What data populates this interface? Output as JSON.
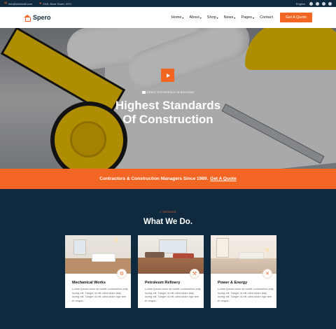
{
  "topbar": {
    "email": "info@webmail.com",
    "address": "24/A, Near Tower, NYC",
    "language": "English"
  },
  "header": {
    "brand": "Spero",
    "nav": [
      {
        "label": "Home",
        "has_dropdown": true
      },
      {
        "label": "About",
        "has_dropdown": true
      },
      {
        "label": "Shop",
        "has_dropdown": true
      },
      {
        "label": "News",
        "has_dropdown": true
      },
      {
        "label": "Pages",
        "has_dropdown": true
      },
      {
        "label": "Contact",
        "has_dropdown": false
      }
    ],
    "cta": "Get A Quote"
  },
  "hero": {
    "kicker": "GREAT EXPERIENCE IN BUILDING",
    "title_line1": "Highest Standards",
    "title_line2": "Of Construction"
  },
  "band": {
    "text": "Contractors & Construction Managers Since 1989.",
    "link": "Get A Quote"
  },
  "services": {
    "kicker": "// SERVICE",
    "title": "What We Do.",
    "cards": [
      {
        "title": "Mechanical Works",
        "desc": "Lorem ipsum dolor sit amett consectetur adip iscing elit. Tanger ut elit olled ullam adip iscing elit. Tanger ut elit olled ullam ege tem et neque."
      },
      {
        "title": "Petroleum Refinery",
        "desc": "Lorem ipsum dolor sit amett consectetur adip iscing elit. Tanger ut elit olled ullam adip iscing elit. Tanger ut elit olled ullam ege tem et neque."
      },
      {
        "title": "Power & Energy",
        "desc": "Lorem ipsum dolor sit amett consectetur adip iscing elit. Tanger ut elit olled ullam adip iscing elit. Tanger ut elit olled ullam ege tem et neque."
      }
    ]
  },
  "colors": {
    "accent": "#f26522",
    "navy": "#0f2a3f"
  }
}
